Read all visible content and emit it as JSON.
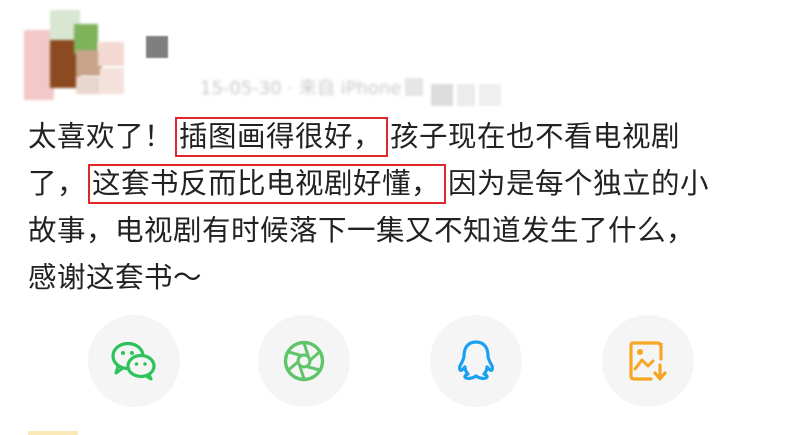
{
  "post": {
    "meta_text": "15-05-30 · 来自 iPhone",
    "comment_lines": [
      {
        "pre": "太喜欢了！",
        "highlight": "插图画得很好，",
        "post": "孩子现在也不看电视剧"
      },
      {
        "pre": "了，",
        "highlight": "这套书反而比电视剧好懂，",
        "post": "因为是每个独立的小"
      },
      {
        "pre": "故事，电视剧有时候落下一集又不知道发生了什么，",
        "highlight": "",
        "post": ""
      },
      {
        "pre": "感谢这套书～",
        "highlight": "",
        "post": ""
      }
    ],
    "highlight_color": "#e0282a"
  },
  "share": {
    "buttons": [
      {
        "icon": "wechat-icon",
        "color": "#2ec35a"
      },
      {
        "icon": "moments-icon",
        "color": "#5fc46a"
      },
      {
        "icon": "qq-icon",
        "color": "#1aa0f0"
      },
      {
        "icon": "save-image-icon",
        "color": "#f5a623"
      }
    ]
  }
}
